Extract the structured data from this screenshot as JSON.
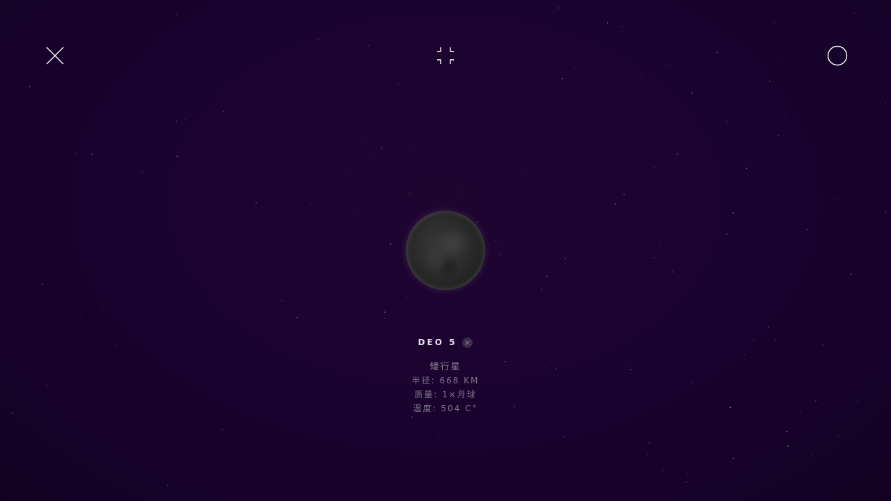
{
  "toolbar": {
    "close_icon": "close-icon",
    "fullscreen_icon": "fullscreen-exit-icon",
    "circle_icon": "circle-icon"
  },
  "planet": {
    "name": "DEO 5",
    "type": "矮行星",
    "radius": "半径: 668 KM",
    "mass": "质量: 1×月球",
    "temperature": "温度: 504 C°"
  },
  "colors": {
    "background": "#1c0330",
    "icon": "#ffffff",
    "label": "#8e8699"
  }
}
